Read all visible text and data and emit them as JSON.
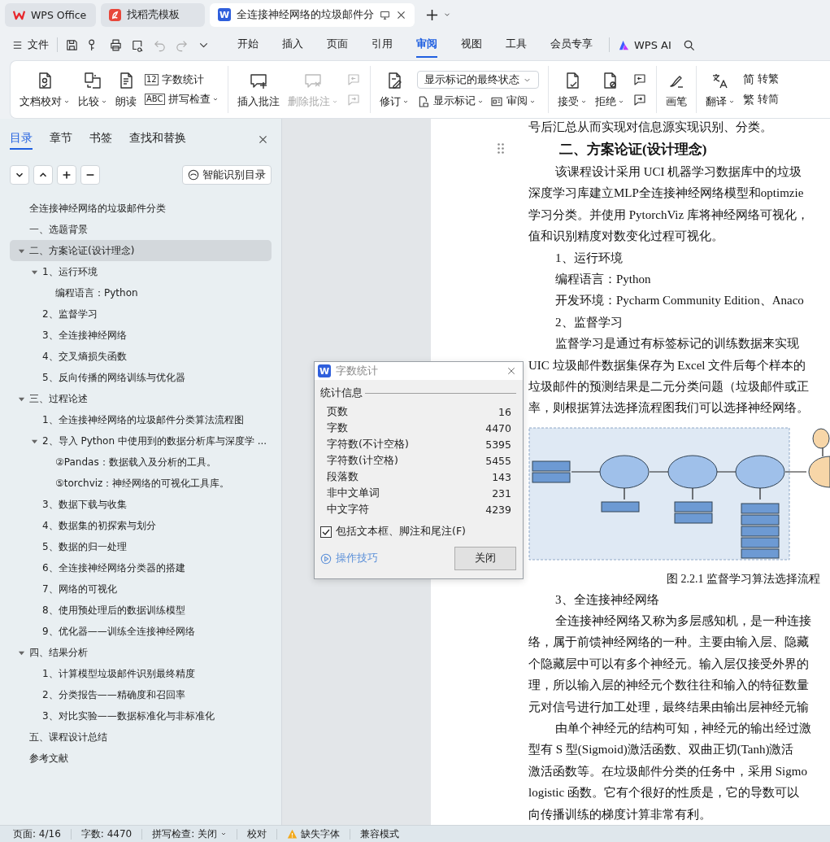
{
  "tabs": [
    {
      "label": "WPS Office",
      "kind": "home",
      "selected": false
    },
    {
      "label": "找稻壳模板",
      "kind": "template",
      "selected": false
    },
    {
      "label": "全连接神经网络的垃圾邮件分",
      "kind": "document",
      "logo": "W",
      "selected": true
    }
  ],
  "menu": {
    "file": "文件",
    "quick_actions": [
      {
        "disabled": false
      },
      {
        "disabled": false
      },
      {
        "disabled": false
      },
      {
        "disabled": false
      },
      {
        "disabled": true
      },
      {
        "disabled": true
      },
      {
        "disabled": false
      }
    ],
    "tabs": [
      {
        "label": "开始",
        "selected": false
      },
      {
        "label": "插入",
        "selected": false
      },
      {
        "label": "页面",
        "selected": false
      },
      {
        "label": "引用",
        "selected": false
      },
      {
        "label": "审阅",
        "selected": true
      },
      {
        "label": "视图",
        "selected": false
      },
      {
        "label": "工具",
        "selected": false
      },
      {
        "label": "会员专享",
        "selected": false
      }
    ],
    "ai": "WPS AI"
  },
  "ribbon": [
    {
      "columns": [
        [
          [
            {
              "kind": "large",
              "label": "文档校对",
              "menu": true,
              "disabled": false
            }
          ]
        ],
        [
          [
            {
              "kind": "large",
              "label": "比较",
              "menu": true,
              "disabled": false
            }
          ]
        ],
        [
          [
            {
              "kind": "large",
              "label": "朗读",
              "menu": false,
              "disabled": false
            }
          ]
        ],
        [
          [
            {
              "kind": "small",
              "icon_text": "12",
              "label": "字数统计",
              "menu": false,
              "disabled": false
            }
          ],
          [
            {
              "kind": "small",
              "icon_text": "ABC",
              "label": "拼写检查",
              "menu": true,
              "disabled": false
            }
          ]
        ]
      ]
    },
    {
      "columns": [
        [
          [
            {
              "kind": "large",
              "label": "插入批注",
              "menu": false,
              "disabled": false
            }
          ]
        ],
        [
          [
            {
              "kind": "large",
              "label": "删除批注",
              "menu": true,
              "disabled": true
            }
          ]
        ],
        [
          [
            {
              "kind": "icon",
              "disabled": true
            }
          ],
          [
            {
              "kind": "icon",
              "disabled": true
            }
          ]
        ]
      ]
    },
    {
      "columns": [
        [
          [
            {
              "kind": "large",
              "label": "修订",
              "menu": true,
              "disabled": false
            }
          ]
        ],
        [
          [
            {
              "kind": "select",
              "value": "显示标记的最终状态"
            }
          ],
          [
            {
              "kind": "small",
              "label": "显示标记",
              "menu": true,
              "disabled": false
            },
            {
              "kind": "small",
              "label": "审阅",
              "menu": true,
              "disabled": false
            }
          ]
        ]
      ]
    },
    {
      "columns": [
        [
          [
            {
              "kind": "large",
              "label": "接受",
              "menu": true,
              "disabled": false
            }
          ]
        ],
        [
          [
            {
              "kind": "large",
              "label": "拒绝",
              "menu": true,
              "disabled": false
            }
          ]
        ],
        [
          [
            {
              "kind": "icon",
              "disabled": false
            }
          ],
          [
            {
              "kind": "icon",
              "disabled": false
            }
          ]
        ]
      ]
    },
    {
      "columns": [
        [
          [
            {
              "kind": "large",
              "label": "画笔",
              "menu": false,
              "disabled": false
            }
          ]
        ]
      ]
    },
    {
      "columns": [
        [
          [
            {
              "kind": "large",
              "label": "翻译",
              "menu": true,
              "disabled": false
            }
          ]
        ],
        [
          [
            {
              "kind": "small",
              "glyph": "简",
              "label": "转繁",
              "menu": false,
              "disabled": false
            }
          ],
          [
            {
              "kind": "small",
              "glyph": "繁",
              "label": "转简",
              "menu": false,
              "disabled": false
            }
          ]
        ]
      ]
    }
  ],
  "sidebar": {
    "tabs": [
      {
        "label": "目录",
        "selected": true
      },
      {
        "label": "章节",
        "selected": false
      },
      {
        "label": "书签",
        "selected": false
      },
      {
        "label": "查找和替换",
        "selected": false
      }
    ],
    "smart_button": "智能识别目录",
    "items": [
      {
        "label": "全连接神经网络的垃圾邮件分类",
        "selected": false
      },
      {
        "label": "一、选题背景",
        "selected": false
      },
      {
        "label": "二、方案论证(设计理念)",
        "selected": true,
        "expanded": true,
        "children": [
          {
            "label": "1、运行环境",
            "selected": false,
            "expanded": true,
            "children": [
              {
                "label": "编程语言：Python",
                "selected": false
              }
            ]
          },
          {
            "label": "2、监督学习",
            "selected": false
          },
          {
            "label": "3、全连接神经网络",
            "selected": false
          },
          {
            "label": "4、交叉熵损失函数",
            "selected": false
          },
          {
            "label": "5、反向传播的网络训练与优化器",
            "selected": false
          }
        ]
      },
      {
        "label": "三、过程论述",
        "selected": false,
        "expanded": true,
        "children": [
          {
            "label": "1、全连接神经网络的垃圾邮件分类算法流程图",
            "selected": false
          },
          {
            "label": "2、导入 Python 中使用到的数据分析库与深度学 ...",
            "selected": false,
            "expanded": true,
            "children": [
              {
                "label": "②Pandas：数据载入及分析的工具。",
                "selected": false
              },
              {
                "label": "⑤torchviz：神经网络的可视化工具库。",
                "selected": false
              }
            ]
          },
          {
            "label": "3、数据下载与收集",
            "selected": false
          },
          {
            "label": "4、数据集的初探索与划分",
            "selected": false
          },
          {
            "label": "5、数据的归一处理",
            "selected": false
          },
          {
            "label": "6、全连接神经网络分类器的搭建",
            "selected": false
          },
          {
            "label": "7、网络的可视化",
            "selected": false
          },
          {
            "label": "8、使用预处理后的数据训练模型",
            "selected": false
          },
          {
            "label": "9、优化器——训练全连接神经网络",
            "selected": false
          }
        ]
      },
      {
        "label": "四、结果分析",
        "selected": false,
        "expanded": true,
        "children": [
          {
            "label": "1、计算模型垃圾邮件识别最终精度",
            "selected": false
          },
          {
            "label": "2、分类报告——精确度和召回率",
            "selected": false
          },
          {
            "label": "3、对比实验——数据标准化与非标准化",
            "selected": false
          }
        ]
      },
      {
        "label": "五、课程设计总结",
        "selected": false
      },
      {
        "label": "参考文献",
        "selected": false
      }
    ]
  },
  "document": {
    "blocks": [
      {
        "kind": "line",
        "text": "号后汇总从而实现对信息源实现识别、分类。"
      },
      {
        "kind": "heading",
        "text": "二、方案论证(设计理念)"
      },
      {
        "kind": "paragraph_start",
        "text": "该课程设计采用 UCI 机器学习数据库中的垃圾"
      },
      {
        "kind": "line",
        "text": "深度学习库建立MLP全连接神经网络模型和optimzie"
      },
      {
        "kind": "line",
        "text": "学习分类。并使用 PytorchViz 库将神经网络可视化，"
      },
      {
        "kind": "line",
        "text": "值和识别精度对数变化过程可视化。"
      },
      {
        "kind": "paragraph_start",
        "text": "1、运行环境"
      },
      {
        "kind": "paragraph_start",
        "text": "编程语言：Python"
      },
      {
        "kind": "paragraph_start",
        "text": "开发环境：Pycharm Community Edition、Anaco"
      },
      {
        "kind": "paragraph_start",
        "text": "2、监督学习"
      },
      {
        "kind": "paragraph_start",
        "text": "监督学习是通过有标签标记的训练数据来实现"
      },
      {
        "kind": "line",
        "text": "UIC 垃圾邮件数据集保存为 Excel 文件后每个样本的"
      },
      {
        "kind": "line",
        "text": "垃圾邮件的预测结果是二元分类问题（垃圾邮件或正"
      },
      {
        "kind": "line",
        "text": "率，则根据算法选择流程图我们可以选择神经网络。"
      },
      {
        "kind": "figure"
      },
      {
        "kind": "caption",
        "text": "图 2.2.1 监督学习算法选择流程"
      },
      {
        "kind": "paragraph_start",
        "text": "3、全连接神经网络"
      },
      {
        "kind": "paragraph_start",
        "text": "全连接神经网络又称为多层感知机，是一种连接"
      },
      {
        "kind": "line",
        "text": "络，属于前馈神经网络的一种。主要由输入层、隐藏"
      },
      {
        "kind": "line",
        "text": "个隐藏层中可以有多个神经元。输入层仅接受外界的"
      },
      {
        "kind": "line",
        "text": "理，所以输入层的神经元个数往往和输入的特征数量"
      },
      {
        "kind": "line",
        "text": "元对信号进行加工处理，最终结果由输出层神经元输"
      },
      {
        "kind": "paragraph_start",
        "text": "由单个神经元的结构可知，神经元的输出经过激"
      },
      {
        "kind": "line",
        "text": "型有 S 型(Sigmoid)激活函数、双曲正切(Tanh)激活"
      },
      {
        "kind": "line",
        "text": "激活函数等。在垃圾邮件分类的任务中，采用 Sigmo"
      },
      {
        "kind": "line",
        "text": "logistic 函数。它有个很好的性质是，它的导数可以"
      },
      {
        "kind": "line",
        "text": "向传播训练的梯度计算非常有利。"
      }
    ]
  },
  "dialog": {
    "logo": "W",
    "title": "字数统计",
    "group": "统计信息",
    "rows": [
      {
        "label": "页数",
        "value": "16"
      },
      {
        "label": "字数",
        "value": "4470"
      },
      {
        "label": "字符数(不计空格)",
        "value": "5395"
      },
      {
        "label": "字符数(计空格)",
        "value": "5455"
      },
      {
        "label": "段落数",
        "value": "143"
      },
      {
        "label": "非中文单词",
        "value": "231"
      },
      {
        "label": "中文字符",
        "value": "4239"
      }
    ],
    "checkbox": {
      "label": "包括文本框、脚注和尾注(F)",
      "checked": true
    },
    "tips": "操作技巧",
    "close": "关闭"
  },
  "status_bar": [
    {
      "label": "页面: 4/16",
      "menu": false,
      "warning": false
    },
    {
      "label": "字数: 4470",
      "menu": false,
      "warning": false
    },
    {
      "label": "拼写检查: 关闭",
      "menu": true,
      "warning": false
    },
    {
      "label": "校对",
      "menu": false,
      "warning": false
    },
    {
      "label": "缺失字体",
      "menu": false,
      "warning": true
    },
    {
      "label": "兼容模式",
      "menu": false,
      "warning": false
    }
  ]
}
